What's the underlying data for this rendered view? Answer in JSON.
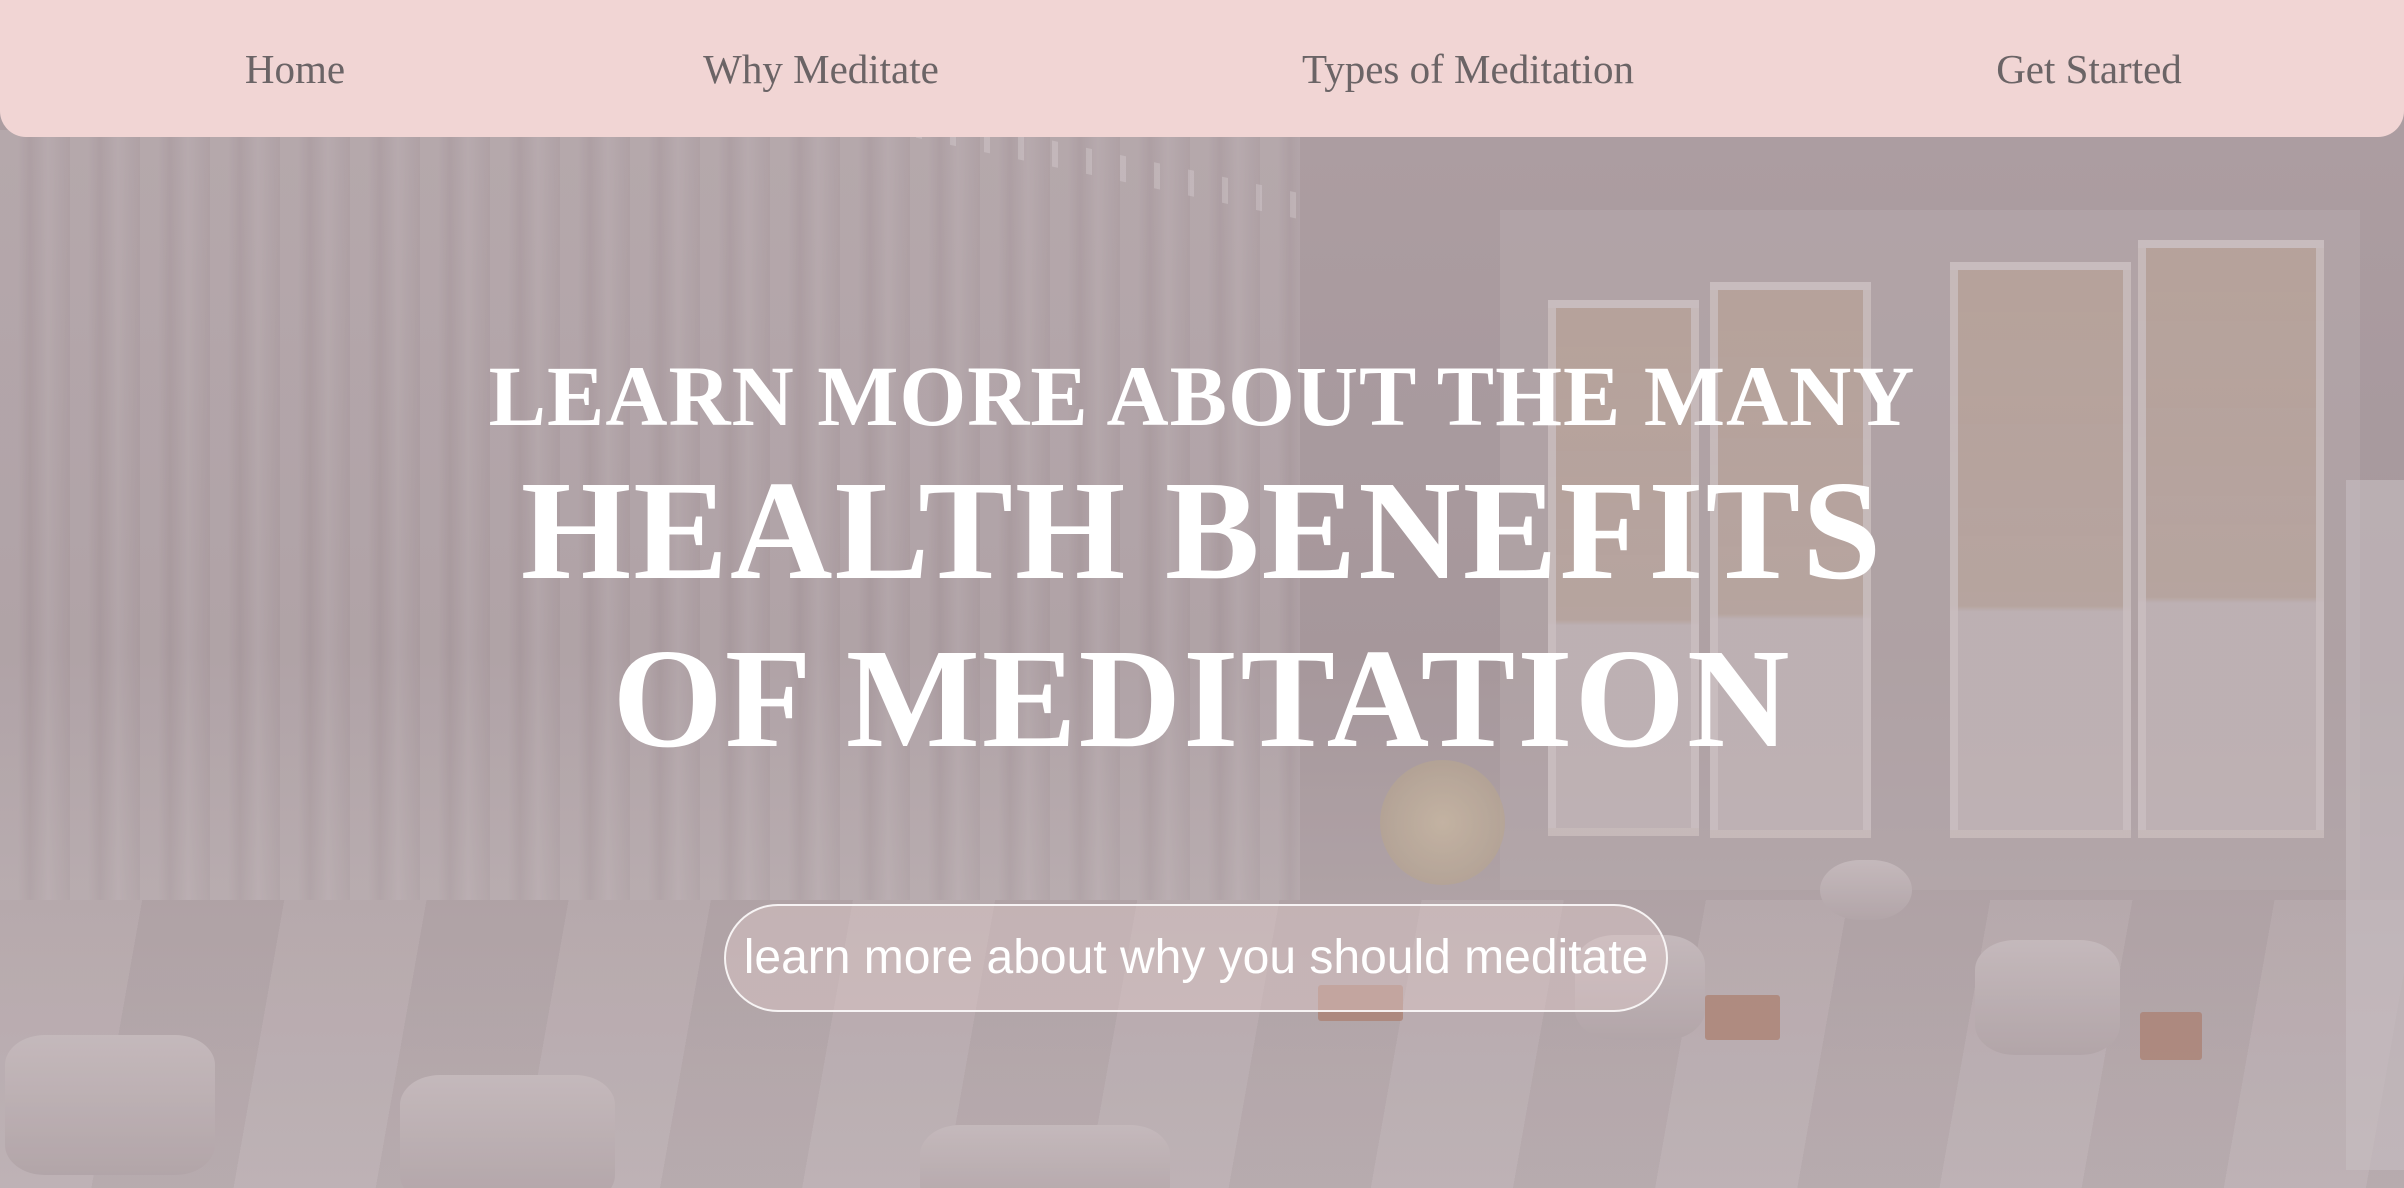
{
  "nav": {
    "items": [
      {
        "label": "Home"
      },
      {
        "label": "Why Meditate"
      },
      {
        "label": "Types of Meditation"
      },
      {
        "label": "Get Started"
      }
    ],
    "background_color": "#f1d5d4",
    "text_color": "#6b6466"
  },
  "hero": {
    "line1": "LEARN MORE ABOUT THE MANY",
    "line2": "HEALTH BENEFITS",
    "line3": "OF MEDITATION",
    "cta_label": "learn more about why you should meditate",
    "text_color": "#ffffff"
  }
}
